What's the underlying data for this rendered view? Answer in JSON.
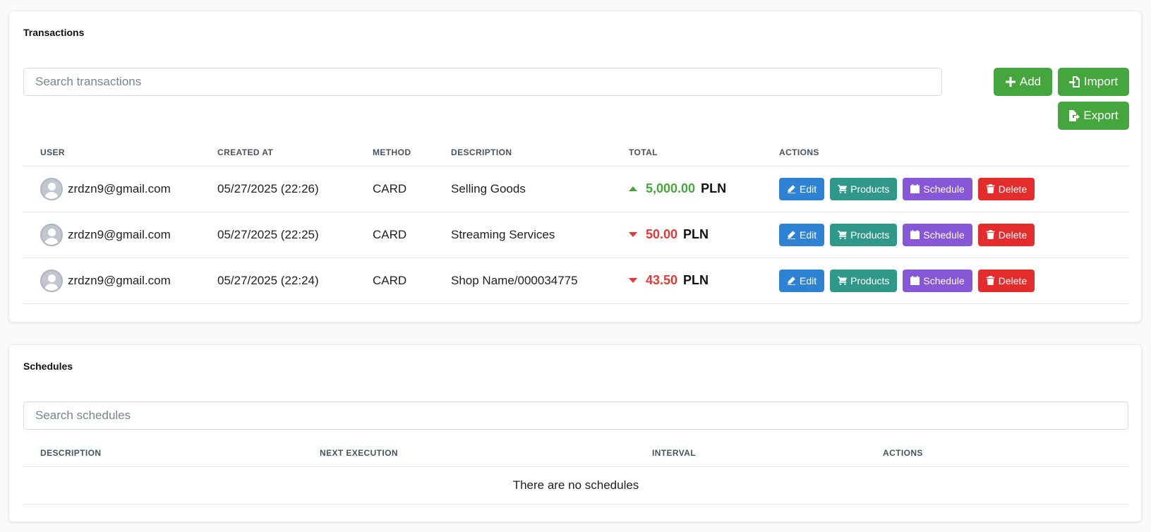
{
  "transactions": {
    "title": "Transactions",
    "search_placeholder": "Search transactions",
    "buttons": {
      "add": "Add",
      "import": "Import",
      "export": "Export"
    },
    "columns": [
      "USER",
      "CREATED AT",
      "METHOD",
      "DESCRIPTION",
      "TOTAL",
      "ACTIONS"
    ],
    "row_actions": {
      "edit": "Edit",
      "products": "Products",
      "schedule": "Schedule",
      "delete": "Delete"
    },
    "rows": [
      {
        "user": "zrdzn9@gmail.com",
        "created_at": "05/27/2025 (22:26)",
        "method": "CARD",
        "description": "Selling Goods",
        "direction": "up",
        "amount": "5,000.00",
        "currency": "PLN"
      },
      {
        "user": "zrdzn9@gmail.com",
        "created_at": "05/27/2025 (22:25)",
        "method": "CARD",
        "description": "Streaming Services",
        "direction": "down",
        "amount": "50.00",
        "currency": "PLN"
      },
      {
        "user": "zrdzn9@gmail.com",
        "created_at": "05/27/2025 (22:24)",
        "method": "CARD",
        "description": "Shop Name/000034775",
        "direction": "down",
        "amount": "43.50",
        "currency": "PLN"
      }
    ]
  },
  "schedules": {
    "title": "Schedules",
    "search_placeholder": "Search schedules",
    "columns": [
      "DESCRIPTION",
      "NEXT EXECUTION",
      "INTERVAL",
      "ACTIONS"
    ],
    "empty_message": "There are no schedules"
  },
  "colors": {
    "green": "#46a63e",
    "edit": "#2e82d4",
    "products": "#2f9889",
    "schedule": "#8757d8",
    "delete": "#e52c2c",
    "negative": "#e53935"
  },
  "icons": {
    "add": "plus-icon",
    "import": "file-import-icon",
    "export": "file-export-icon",
    "edit": "edit-icon",
    "products": "cart-icon",
    "schedule": "calendar-icon",
    "delete": "trash-icon",
    "user": "user-avatar-icon"
  }
}
